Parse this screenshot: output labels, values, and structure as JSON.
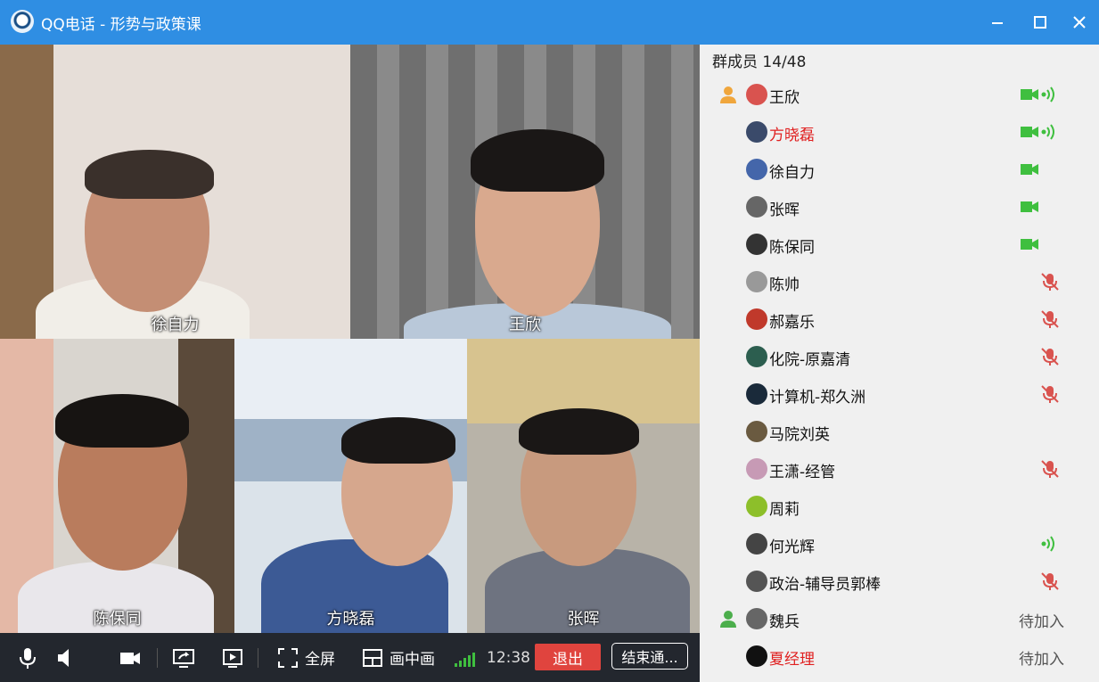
{
  "window": {
    "title": "QQ电话 - 形势与政策课",
    "icons": [
      "qq-phone-logo-icon",
      "minimize-icon",
      "maximize-icon",
      "close-icon"
    ]
  },
  "video_tiles": [
    {
      "name": "徐自力"
    },
    {
      "name": "王欣"
    },
    {
      "name": "陈保同"
    },
    {
      "name": "方晓磊"
    },
    {
      "name": "张晖"
    }
  ],
  "toolbar": {
    "fullscreen_label": "全屏",
    "pip_label": "画中画",
    "time": "12:38",
    "exit_label": "退出",
    "end_label": "结束通..."
  },
  "members": {
    "count_label": "群成员 14/48",
    "items": [
      {
        "name": "王欣",
        "owner": true,
        "camera": true,
        "speaking": true,
        "muted": false,
        "status": "",
        "red": false,
        "avatar_color": "#d9534f"
      },
      {
        "name": "方晓磊",
        "owner": false,
        "camera": true,
        "speaking": true,
        "muted": false,
        "status": "",
        "red": true,
        "avatar_color": "#3a4a6a"
      },
      {
        "name": "徐自力",
        "owner": false,
        "camera": true,
        "speaking": false,
        "muted": false,
        "status": "",
        "red": false,
        "avatar_color": "#4466aa"
      },
      {
        "name": "张晖",
        "owner": false,
        "camera": true,
        "speaking": false,
        "muted": false,
        "status": "",
        "red": false,
        "avatar_color": "#666666"
      },
      {
        "name": "陈保同",
        "owner": false,
        "camera": true,
        "speaking": false,
        "muted": false,
        "status": "",
        "red": false,
        "avatar_color": "#333333"
      },
      {
        "name": "陈帅",
        "owner": false,
        "camera": false,
        "speaking": false,
        "muted": true,
        "status": "",
        "red": false,
        "avatar_color": "#999999"
      },
      {
        "name": "郝嘉乐",
        "owner": false,
        "camera": false,
        "speaking": false,
        "muted": true,
        "status": "",
        "red": false,
        "avatar_color": "#c0392b"
      },
      {
        "name": "化院-原嘉清",
        "owner": false,
        "camera": false,
        "speaking": false,
        "muted": true,
        "status": "",
        "red": false,
        "avatar_color": "#2c5e4f"
      },
      {
        "name": "计算机-郑久洲",
        "owner": false,
        "camera": false,
        "speaking": false,
        "muted": true,
        "status": "",
        "red": false,
        "avatar_color": "#1a2a3a"
      },
      {
        "name": "马院刘英",
        "owner": false,
        "camera": false,
        "speaking": false,
        "muted": false,
        "status": "",
        "red": false,
        "avatar_color": "#6a5a40"
      },
      {
        "name": "王潇-经管",
        "owner": false,
        "camera": false,
        "speaking": false,
        "muted": true,
        "status": "",
        "red": false,
        "avatar_color": "#c79ab5"
      },
      {
        "name": "周莉",
        "owner": false,
        "camera": false,
        "speaking": false,
        "muted": false,
        "status": "",
        "red": false,
        "avatar_color": "#8dbf2a"
      },
      {
        "name": "何光辉",
        "owner": false,
        "camera": false,
        "speaking": true,
        "muted": false,
        "status": "",
        "red": false,
        "avatar_color": "#444444"
      },
      {
        "name": "政治-辅导员郭棒",
        "owner": false,
        "camera": false,
        "speaking": false,
        "muted": true,
        "status": "",
        "red": false,
        "avatar_color": "#555555"
      },
      {
        "name": "魏兵",
        "owner": true,
        "owner_color": "green",
        "camera": false,
        "speaking": false,
        "muted": false,
        "status": "待加入",
        "red": false,
        "avatar_color": "#666666"
      },
      {
        "name": "夏经理",
        "owner": false,
        "camera": false,
        "speaking": false,
        "muted": false,
        "status": "待加入",
        "red": true,
        "avatar_color": "#111111"
      }
    ]
  },
  "colors": {
    "titlebar": "#2f8ee3",
    "exit_button": "#e0443e",
    "camera_active": "#3fbf3f",
    "muted": "#d9534f"
  }
}
